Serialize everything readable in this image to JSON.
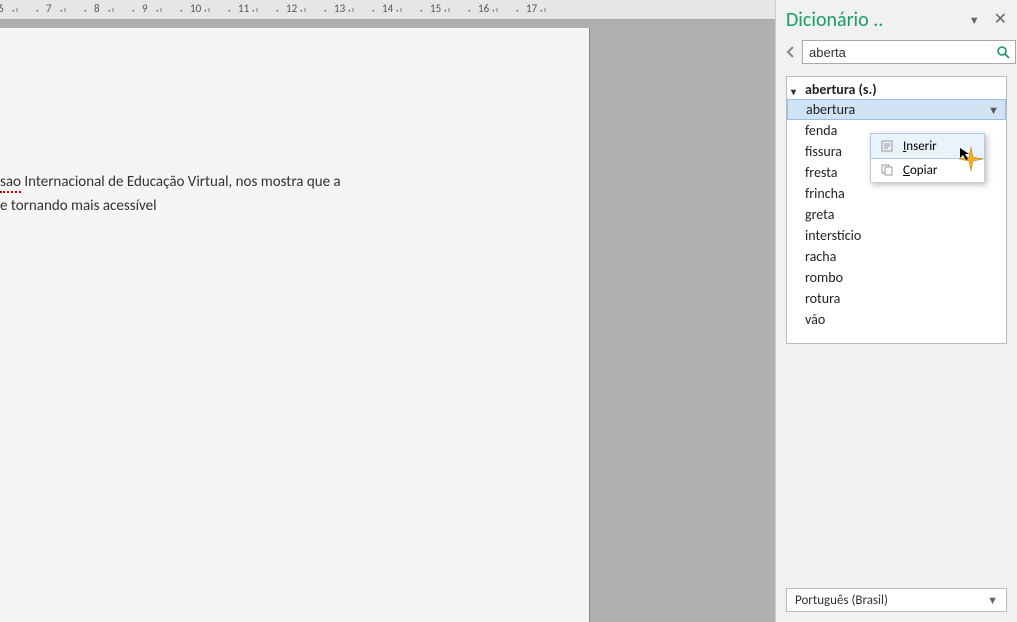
{
  "ruler": {
    "marks": [
      "6",
      "7",
      "8",
      "9",
      "10",
      "11",
      "12",
      "13",
      "14",
      "15",
      "16",
      "17"
    ]
  },
  "document": {
    "line1_pre": "sao",
    "line1_rest": " Internacional de Educação Virtual, nos mostra que a",
    "line2": "e tornando mais acessível"
  },
  "panel": {
    "title": "Dicionário ..",
    "search_value": "aberta",
    "result_header": "abertura (s.)",
    "items": [
      "abertura",
      "fenda",
      "fissura",
      "fresta",
      "frincha",
      "greta",
      "interstício",
      "racha",
      "rombo",
      "rotura",
      "vão"
    ],
    "selected_index": 0,
    "language": "Português (Brasil)"
  },
  "context_menu": {
    "insert": "Inserir",
    "copy": "Copiar"
  }
}
